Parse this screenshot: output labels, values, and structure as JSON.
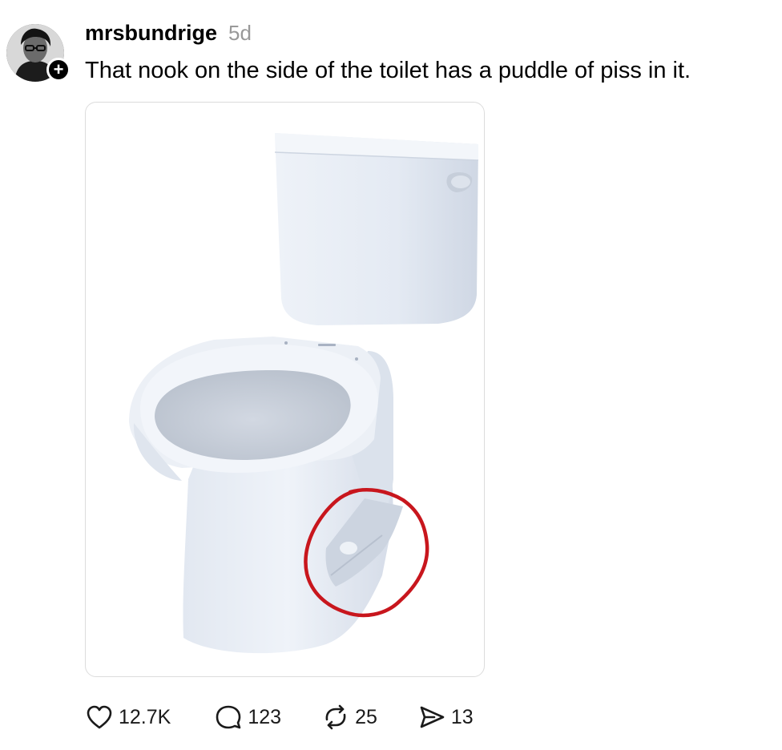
{
  "post": {
    "username": "mrsbundrige",
    "timestamp": "5d",
    "text": "That nook on the side of the toilet has a puddle of piss in it.",
    "follow_badge": "+",
    "media_alt": "toilet-photo-with-red-circle-annotation"
  },
  "actions": {
    "likes": "12.7K",
    "replies": "123",
    "reposts": "25",
    "shares": "13"
  },
  "icons": {
    "like": "heart-icon",
    "reply": "speech-bubble-icon",
    "repost": "repost-arrows-icon",
    "share": "paper-plane-icon"
  },
  "colors": {
    "timestamp": "#999999",
    "annotation": "#c8161d",
    "toilet": "#e6ebf3"
  }
}
